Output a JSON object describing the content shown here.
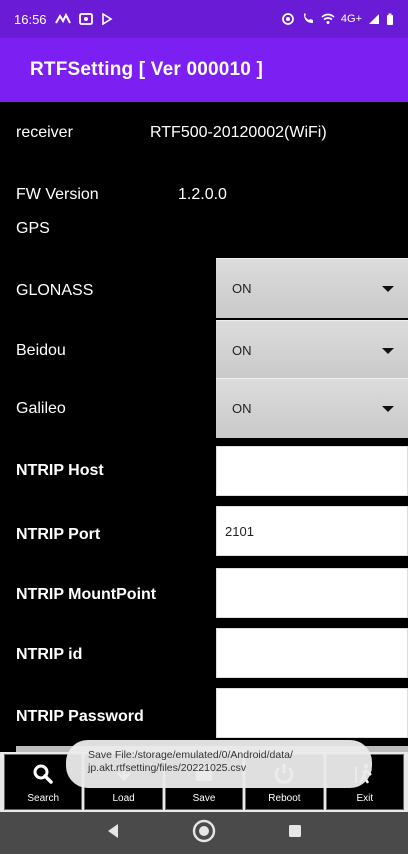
{
  "status_bar": {
    "time": "16:56",
    "right_text": "4G+"
  },
  "app_bar": {
    "title": "RTFSetting  [ Ver 000010 ]"
  },
  "info": {
    "receiver_label": "receiver",
    "receiver_value": "RTF500-20120002(WiFi)",
    "fw_label": "FW Version",
    "fw_value": "1.2.0.0",
    "gps_label": "GPS"
  },
  "settings": {
    "glonass_label": "GLONASS",
    "glonass_value": "ON",
    "beidou_label": "Beidou",
    "beidou_value": "ON",
    "galileo_label": "Galileo",
    "galileo_value": "ON",
    "ntrip_host_label": "NTRIP Host",
    "ntrip_host_value": "",
    "ntrip_port_label": "NTRIP Port",
    "ntrip_port_value": "2101",
    "ntrip_mount_label": "NTRIP MountPoint",
    "ntrip_mount_value": "",
    "ntrip_id_label": "NTRIP id",
    "ntrip_id_value": "",
    "ntrip_password_label": "NTRIP Password",
    "ntrip_password_value": ""
  },
  "toolbar": {
    "search": "Search",
    "load": "Load",
    "save": "Save",
    "reboot": "Reboot",
    "exit": "Exit"
  },
  "toast": {
    "line1": "Save File:/storage/emulated/0/Android/data/",
    "line2": "jp.akt.rtfsetting/files/20221025.csv"
  },
  "colors": {
    "status_bar": "#6a1bd6",
    "app_bar": "#7c1ff2"
  }
}
